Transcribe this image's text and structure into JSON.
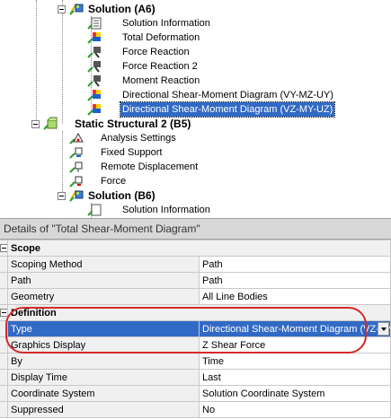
{
  "tree": {
    "solution_a6": "Solution (A6)",
    "solution_information": "Solution Information",
    "total_deformation": "Total Deformation",
    "force_reaction": "Force Reaction",
    "force_reaction_2": "Force Reaction 2",
    "moment_reaction": "Moment Reaction",
    "dsm_vy": "Directional Shear-Moment Diagram (VY-MZ-UY)",
    "dsm_vz": "Directional Shear-Moment Diagram (VZ-MY-UZ)",
    "static_structural_2": "Static Structural 2 (B5)",
    "analysis_settings": "Analysis Settings",
    "fixed_support": "Fixed Support",
    "remote_displacement": "Remote Displacement",
    "force": "Force",
    "solution_b6": "Solution (B6)",
    "solution_information_b6": "Solution Information"
  },
  "details": {
    "header": "Details of \"Total Shear-Moment Diagram\"",
    "scope": {
      "label": "Scope",
      "scoping_method": {
        "name": "Scoping Method",
        "value": "Path"
      },
      "path": {
        "name": "Path",
        "value": "Path"
      },
      "geometry": {
        "name": "Geometry",
        "value": "All Line Bodies"
      }
    },
    "definition": {
      "label": "Definition",
      "type": {
        "name": "Type",
        "value": "Directional Shear-Moment Diagram (VZ-MY-UZ)"
      },
      "graphics_display": {
        "name": "Graphics Display",
        "value": "Z Shear Force"
      },
      "by": {
        "name": "By",
        "value": "Time"
      },
      "display_time": {
        "name": "Display Time",
        "value": "Last"
      },
      "coordinate_system": {
        "name": "Coordinate System",
        "value": "Solution Coordinate System"
      },
      "suppressed": {
        "name": "Suppressed",
        "value": "No"
      }
    }
  },
  "colors": {
    "selection": "#316ac5",
    "highlight_ring": "#d42a2a"
  }
}
